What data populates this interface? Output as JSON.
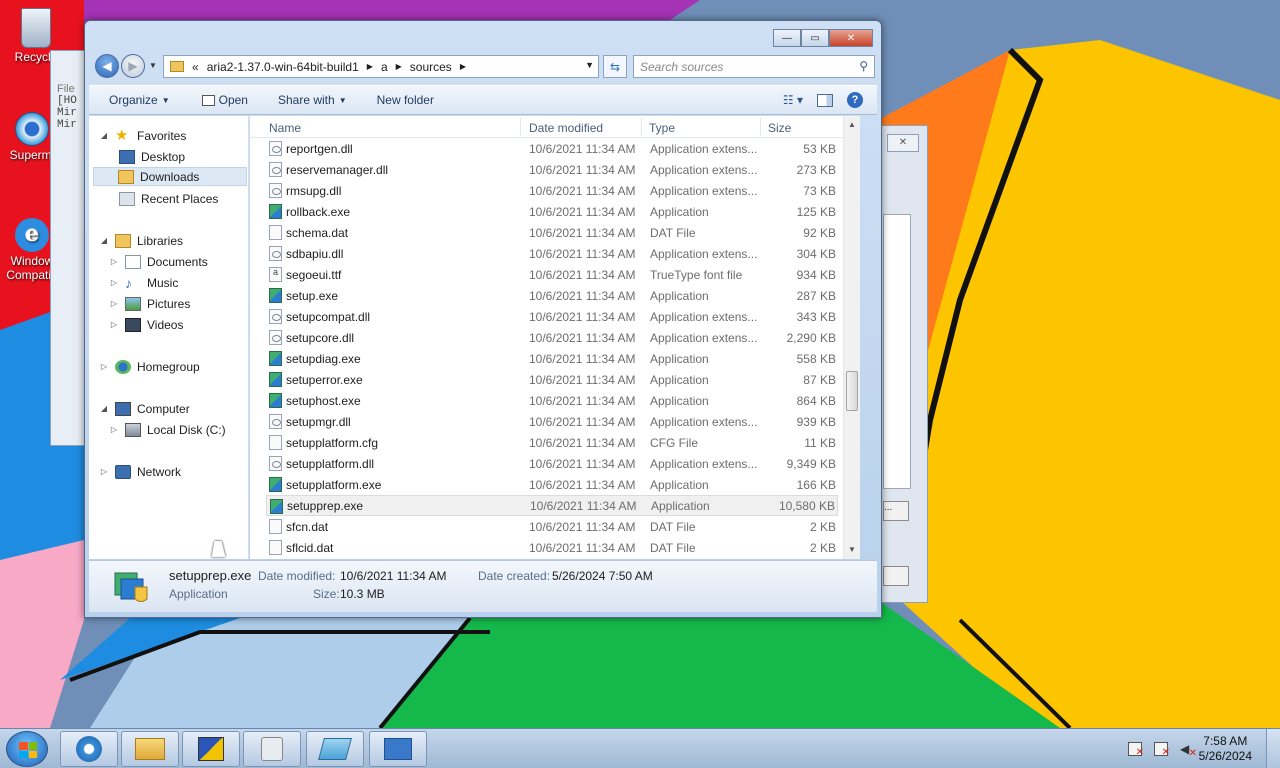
{
  "desktop": {
    "icons": [
      {
        "label": "Recycle"
      },
      {
        "label": "Supermi"
      },
      {
        "label": "Window Compatib"
      }
    ],
    "bg_window_text": [
      "File",
      "[HO",
      "Mir",
      "Mir"
    ]
  },
  "explorer": {
    "address": {
      "chevron": "«",
      "segments": [
        "aria2-1.37.0-win-64bit-build1",
        "a",
        "sources"
      ]
    },
    "search_placeholder": "Search sources",
    "toolbar": {
      "organize": "Organize",
      "open": "Open",
      "share_with": "Share with",
      "new_folder": "New folder"
    },
    "nav": {
      "favorites": "Favorites",
      "desktop": "Desktop",
      "downloads": "Downloads",
      "recent_places": "Recent Places",
      "libraries": "Libraries",
      "documents": "Documents",
      "music": "Music",
      "pictures": "Pictures",
      "videos": "Videos",
      "homegroup": "Homegroup",
      "computer": "Computer",
      "local_disk": "Local Disk (C:)",
      "network": "Network"
    },
    "columns": {
      "name": "Name",
      "date_modified": "Date modified",
      "type": "Type",
      "size": "Size"
    },
    "files": [
      {
        "name": "reportgen.dll",
        "date": "10/6/2021 11:34 AM",
        "type": "Application extens...",
        "size": "53 KB",
        "icon": "dll"
      },
      {
        "name": "reservemanager.dll",
        "date": "10/6/2021 11:34 AM",
        "type": "Application extens...",
        "size": "273 KB",
        "icon": "dll"
      },
      {
        "name": "rmsupg.dll",
        "date": "10/6/2021 11:34 AM",
        "type": "Application extens...",
        "size": "73 KB",
        "icon": "dll"
      },
      {
        "name": "rollback.exe",
        "date": "10/6/2021 11:34 AM",
        "type": "Application",
        "size": "125 KB",
        "icon": "exe"
      },
      {
        "name": "schema.dat",
        "date": "10/6/2021 11:34 AM",
        "type": "DAT File",
        "size": "92 KB",
        "icon": "file"
      },
      {
        "name": "sdbapiu.dll",
        "date": "10/6/2021 11:34 AM",
        "type": "Application extens...",
        "size": "304 KB",
        "icon": "dll"
      },
      {
        "name": "segoeui.ttf",
        "date": "10/6/2021 11:34 AM",
        "type": "TrueType font file",
        "size": "934 KB",
        "icon": "ttf"
      },
      {
        "name": "setup.exe",
        "date": "10/6/2021 11:34 AM",
        "type": "Application",
        "size": "287 KB",
        "icon": "exe"
      },
      {
        "name": "setupcompat.dll",
        "date": "10/6/2021 11:34 AM",
        "type": "Application extens...",
        "size": "343 KB",
        "icon": "dll"
      },
      {
        "name": "setupcore.dll",
        "date": "10/6/2021 11:34 AM",
        "type": "Application extens...",
        "size": "2,290 KB",
        "icon": "dll"
      },
      {
        "name": "setupdiag.exe",
        "date": "10/6/2021 11:34 AM",
        "type": "Application",
        "size": "558 KB",
        "icon": "exe"
      },
      {
        "name": "setuperror.exe",
        "date": "10/6/2021 11:34 AM",
        "type": "Application",
        "size": "87 KB",
        "icon": "exe"
      },
      {
        "name": "setuphost.exe",
        "date": "10/6/2021 11:34 AM",
        "type": "Application",
        "size": "864 KB",
        "icon": "exe"
      },
      {
        "name": "setupmgr.dll",
        "date": "10/6/2021 11:34 AM",
        "type": "Application extens...",
        "size": "939 KB",
        "icon": "dll"
      },
      {
        "name": "setupplatform.cfg",
        "date": "10/6/2021 11:34 AM",
        "type": "CFG File",
        "size": "11 KB",
        "icon": "file"
      },
      {
        "name": "setupplatform.dll",
        "date": "10/6/2021 11:34 AM",
        "type": "Application extens...",
        "size": "9,349 KB",
        "icon": "dll"
      },
      {
        "name": "setupplatform.exe",
        "date": "10/6/2021 11:34 AM",
        "type": "Application",
        "size": "166 KB",
        "icon": "exe"
      },
      {
        "name": "setupprep.exe",
        "date": "10/6/2021 11:34 AM",
        "type": "Application",
        "size": "10,580 KB",
        "icon": "exe",
        "selected": true
      },
      {
        "name": "sfcn.dat",
        "date": "10/6/2021 11:34 AM",
        "type": "DAT File",
        "size": "2 KB",
        "icon": "file"
      },
      {
        "name": "sflcid.dat",
        "date": "10/6/2021 11:34 AM",
        "type": "DAT File",
        "size": "2 KB",
        "icon": "file"
      }
    ],
    "details": {
      "name": "setupprep.exe",
      "kind": "Application",
      "date_modified_label": "Date modified:",
      "date_modified": "10/6/2021 11:34 AM",
      "date_created_label": "Date created:",
      "date_created": "5/26/2024 7:50 AM",
      "size_label": "Size:",
      "size": "10.3 MB"
    }
  },
  "taskbar": {
    "time": "7:58 AM",
    "date": "5/26/2024"
  },
  "colors": {
    "desktop_red": "#e8121e",
    "desktop_yellow": "#fcc500",
    "desktop_orange": "#ff7a1a",
    "desktop_green": "#15b84a",
    "desktop_blue": "#1e8ce0",
    "desktop_slate": "#6f8fb8",
    "desktop_purple": "#a533b5",
    "explorer_frame": "#b9d1ec"
  }
}
